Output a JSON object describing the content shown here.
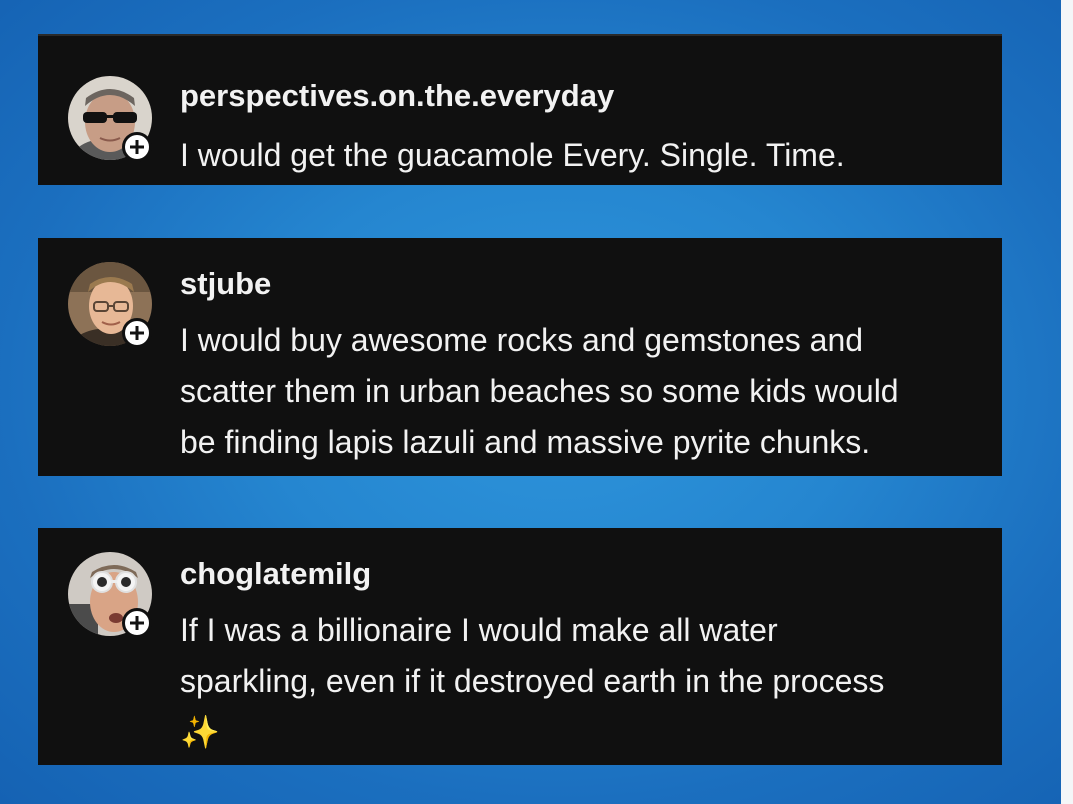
{
  "comments": [
    {
      "username": "perspectives.on.the.everyday",
      "lines": [
        "I would get the guacamole Every.  Single. Time."
      ],
      "avatar_icon": "avatar-man-sunglasses",
      "badge_icon": "plus-icon"
    },
    {
      "username": "stjube",
      "lines": [
        "I would buy awesome rocks and gemstones and",
        "scatter them in urban beaches so some kids would",
        "be finding lapis lazuli and massive pyrite chunks."
      ],
      "avatar_icon": "avatar-person-glasses",
      "badge_icon": "plus-icon"
    },
    {
      "username": "choglatemilg",
      "lines": [
        "If I was a billionaire I would make all water",
        "sparkling, even if it destroyed earth in the process",
        "✨"
      ],
      "avatar_icon": "avatar-person-white-sunglasses",
      "badge_icon": "plus-icon"
    }
  ],
  "colors": {
    "background": "#2586d0",
    "card": "#101010",
    "text": "#f2f2f2",
    "badge": "#ffffff"
  }
}
